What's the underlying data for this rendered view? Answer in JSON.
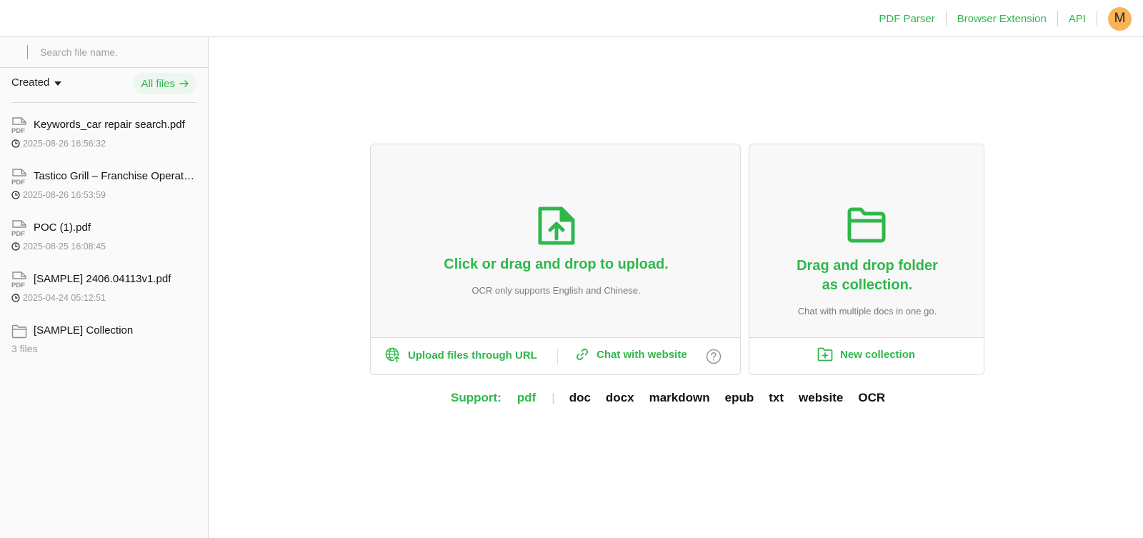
{
  "header": {
    "nav": [
      {
        "label": "PDF Parser"
      },
      {
        "label": "Browser Extension"
      },
      {
        "label": "API"
      }
    ],
    "avatar_initial": "M",
    "avatar_color": "#f7b456"
  },
  "sidebar": {
    "search_placeholder": "Search file name.",
    "sort_label": "Created",
    "all_files_label": "All files",
    "files": [
      {
        "type": "pdf",
        "name": "Keywords_car repair search.pdf",
        "time": "2025-08-26 16:56:32"
      },
      {
        "type": "pdf",
        "name": "Tastico Grill – Franchise Operations.pdf",
        "time": "2025-08-26 16:53:59"
      },
      {
        "type": "pdf",
        "name": "POC (1).pdf",
        "time": "2025-08-25 16:08:45"
      },
      {
        "type": "pdf",
        "name": "[SAMPLE] 2406.04113v1.pdf",
        "time": "2025-04-24 05:12:51"
      }
    ],
    "collection": {
      "name": "[SAMPLE] Collection",
      "count": "3 files"
    }
  },
  "upload_card": {
    "title": "Click or drag and drop to upload.",
    "subtitle": "OCR only supports English and Chinese.",
    "url_button": "Upload files through URL",
    "website_button": "Chat with website"
  },
  "folder_card": {
    "title_line1": "Drag and drop folder",
    "title_line2": "as collection.",
    "subtitle": "Chat with multiple docs in one go.",
    "new_collection_button": "New collection"
  },
  "support": {
    "label": "Support:",
    "primary": "pdf",
    "formats": [
      "doc",
      "docx",
      "markdown",
      "epub",
      "txt",
      "website",
      "OCR"
    ]
  },
  "colors": {
    "accent": "#2eb84b",
    "border": "#dcdcdc",
    "sidebar_bg": "#fafafa",
    "muted": "#9a9a9a"
  }
}
